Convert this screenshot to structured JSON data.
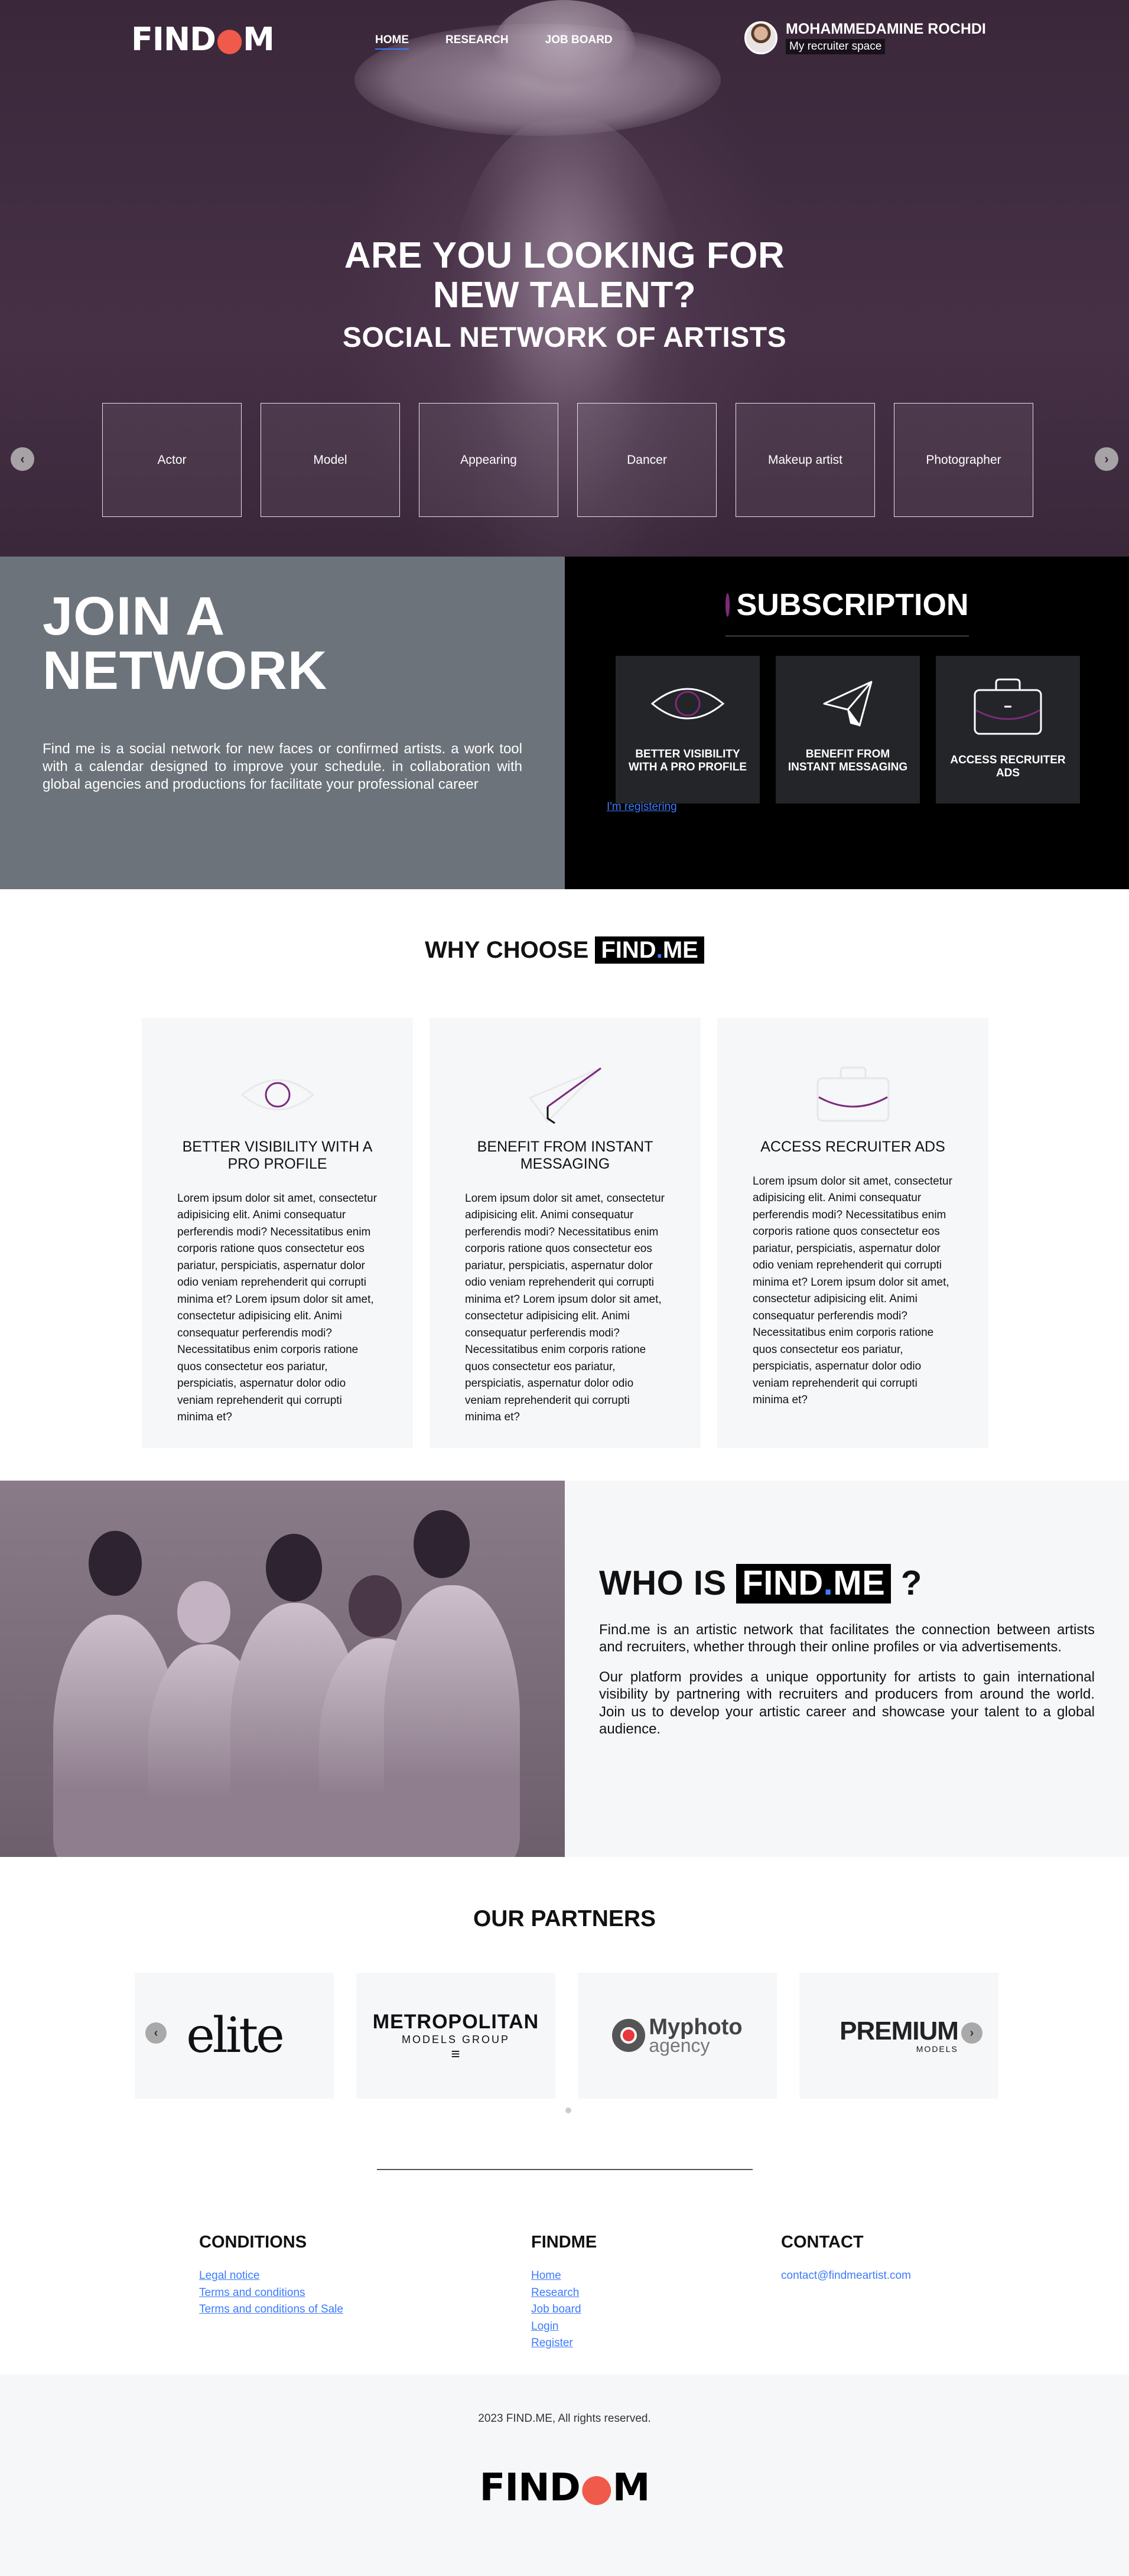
{
  "header": {
    "logo_prefix": "FIND",
    "logo_suffix": "M",
    "nav": [
      {
        "label": "HOME"
      },
      {
        "label": "RESEARCH"
      },
      {
        "label": "JOB BOARD"
      }
    ],
    "user": {
      "name": "MOHAMMEDAMINE ROCHDI",
      "subtitle": "My recruiter space"
    }
  },
  "hero": {
    "title_line1": "ARE YOU LOOKING FOR",
    "title_line2": "NEW TALENT?",
    "subtitle": "SOCIAL NETWORK OF ARTISTS",
    "categories": [
      "Actor",
      "Model",
      "Appearing",
      "Dancer",
      "Makeup artist",
      "Photographer"
    ],
    "prev_icon": "chevron-left-icon",
    "next_icon": "chevron-right-icon"
  },
  "join": {
    "title": "JOIN A NETWORK",
    "text": "Find me is a social network for new faces or confirmed artists. a work tool with a calendar designed to improve your schedule. in collaboration with global agencies and productions for facilitate your professional career"
  },
  "subscription": {
    "title": "SUBSCRIPTION",
    "cards": [
      {
        "label": "BETTER VISIBILITY WITH A PRO PROFILE",
        "icon": "eye-icon"
      },
      {
        "label": "BENEFIT FROM INSTANT MESSAGING",
        "icon": "paper-plane-icon"
      },
      {
        "label": "ACCESS RECRUITER ADS",
        "icon": "briefcase-icon"
      }
    ],
    "register_link": "I'm registering",
    "accent": "#7c2b7c"
  },
  "why": {
    "title_prefix": "WHY CHOOSE",
    "brand_a": "FIND",
    "brand_dot": ".",
    "brand_b": "ME",
    "cards": [
      {
        "title": "BETTER VISIBILITY WITH A PRO PROFILE",
        "icon": "eye-icon",
        "text": "Lorem ipsum dolor sit amet, consectetur adipisicing elit. Animi consequatur perferendis modi? Necessitatibus enim corporis ratione quos consectetur eos pariatur, perspiciatis, aspernatur dolor odio veniam reprehenderit qui corrupti minima et? Lorem ipsum dolor sit amet, consectetur adipisicing elit. Animi consequatur perferendis modi? Necessitatibus enim corporis ratione quos consectetur eos pariatur, perspiciatis, aspernatur dolor odio veniam reprehenderit qui corrupti minima et?"
      },
      {
        "title": "BENEFIT FROM INSTANT MESSAGING",
        "icon": "paper-plane-icon",
        "text": "Lorem ipsum dolor sit amet, consectetur adipisicing elit. Animi consequatur perferendis modi? Necessitatibus enim corporis ratione quos consectetur eos pariatur, perspiciatis, aspernatur dolor odio veniam reprehenderit qui corrupti minima et? Lorem ipsum dolor sit amet, consectetur adipisicing elit. Animi consequatur perferendis modi? Necessitatibus enim corporis ratione quos consectetur eos pariatur, perspiciatis, aspernatur dolor odio veniam reprehenderit qui corrupti minima et?"
      },
      {
        "title": "ACCESS RECRUITER ADS",
        "icon": "briefcase-icon",
        "text": "Lorem ipsum dolor sit amet, consectetur adipisicing elit. Animi consequatur perferendis modi? Necessitatibus enim corporis ratione quos consectetur eos pariatur, perspiciatis, aspernatur dolor odio veniam reprehenderit qui corrupti minima et? Lorem ipsum dolor sit amet, consectetur adipisicing elit. Animi consequatur perferendis modi? Necessitatibus enim corporis ratione quos consectetur eos pariatur, perspiciatis, aspernatur dolor odio veniam reprehenderit qui corrupti minima et?"
      }
    ]
  },
  "who": {
    "title_prefix": "WHO IS",
    "brand_a": "FIND",
    "brand_dot": ".",
    "brand_b": "ME",
    "title_suffix": "?",
    "p1": "Find.me is an artistic network that facilitates the connection between artists and recruiters, whether through their online profiles or via advertisements.",
    "p2": "Our platform provides a unique opportunity for artists to gain international visibility by partnering with recruiters and producers from around the world. Join us to develop your artistic career and showcase your talent to a global audience."
  },
  "partners": {
    "title": "OUR PARTNERS",
    "elite": "elite",
    "metropolitan": "METROPOLITAN",
    "metropolitan_sub": "MODELS GROUP",
    "myphoto": "Myphoto",
    "myphoto_sub": "agency",
    "premium": "PREMIUM",
    "premium_sub": "MODELS"
  },
  "footer": {
    "conditions_title": "CONDITIONS",
    "conditions_links": [
      "Legal notice",
      "Terms and conditions",
      "Terms and conditions of Sale"
    ],
    "findme_title": "FINDME",
    "findme_links": [
      "Home",
      "Research",
      "Job board",
      "Login",
      "Register"
    ],
    "contact_title": "CONTACT",
    "contact_email": "contact@findmeartist.com",
    "copyright": "2023 FIND.ME, All rights reserved.",
    "logo_prefix": "FIND",
    "logo_suffix": "M"
  }
}
